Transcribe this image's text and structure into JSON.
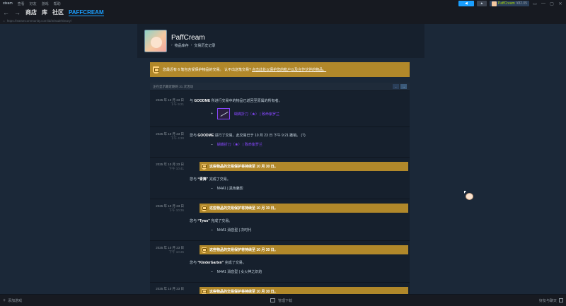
{
  "menu": {
    "logo": "steam",
    "items": [
      "查看",
      "好友",
      "游戏",
      "帮助"
    ]
  },
  "topright": {
    "announce_icon": "megaphone-icon",
    "notify_icon": "bell-icon",
    "username": "PaffCream",
    "balance": "¥82.05",
    "window": [
      "▭",
      "—",
      "▢",
      "✕"
    ]
  },
  "nav": {
    "back": "←",
    "forward": "→",
    "links": [
      "商店",
      "库",
      "社区",
      "PAFFCREAM"
    ]
  },
  "url": "https://steamcommunity.com/id/2/tradehistory/",
  "profile": {
    "name": "PaffCream",
    "crumbs": [
      "物品库存",
      "交易历史记录"
    ]
  },
  "warning": {
    "text": "您最近有 6 笔包含受保护物品的交易。 认不出这笔交易?",
    "link": "点击此处以保护您的帐户以及合作伙伴的物品。"
  },
  "filter": {
    "text": "正在显示最近期的 31 次活动",
    "btn1": "⌄",
    "btn2": "→"
  },
  "entries": [
    {
      "date": "2025 年 10 月 23 日",
      "time": "下午 9:21",
      "text_pre": "与 ",
      "user": "GOODME",
      "text_post": " 所进行交易中的物品已返回至原属的所有者。",
      "sign": "+",
      "item": "蝴蝶折刀（★） | 致命紫罗兰"
    },
    {
      "date": "2025 年 10 月 23 日",
      "time": "下午 4:30",
      "text_pre": "您与 ",
      "user": "GOODME",
      "text_post": " 进行了交易。此交易已于 10 月 23 日 下午 9:21 撤销。 (?)",
      "sign": "–",
      "item": "蝴蝶折刀（★） | 致命紫罗兰"
    },
    {
      "date": "2025 年 10 月 23 日",
      "time": "下午 10:41",
      "banner": "这些物品的交易保护将持续至 10 月 30 日。",
      "text_pre": "您与 ",
      "user": "“青舞”",
      "text_post": " 完成了交易。",
      "sign": "–",
      "item": "M4A1 | 黑色魅影"
    },
    {
      "date": "2025 年 10 月 23 日",
      "time": "下午 10:36",
      "banner": "这些物品的交易保护将持续至 10 月 30 日。",
      "text_pre": "您与 ",
      "user": "“Tywo”",
      "text_post": " 完成了交易。",
      "sign": "–",
      "item": "M4A1 消音型 | 次时代"
    },
    {
      "date": "2025 年 10 月 23 日",
      "time": "下午 10:35",
      "banner": "这些物品的交易保护将持续至 10 月 30 日。",
      "text_pre": "您与 ",
      "user": "“KinderGarten”",
      "text_post": " 完成了交易。",
      "sign": "–",
      "item": "M4A1 消音型 | 女火神之炽焰"
    },
    {
      "date": "2025 年 10 月 23 日",
      "time": "",
      "banner": "这些物品的交易保护将持续至 10 月 30 日。"
    }
  ],
  "bottom": {
    "add_game": "添加游戏",
    "downloads": "管理下载",
    "friends": "好友与聊天"
  },
  "colors": {
    "accent": "#1a9fff",
    "gold": "#b1882a",
    "purple": "#8847ff",
    "bg": "#1b2838"
  }
}
